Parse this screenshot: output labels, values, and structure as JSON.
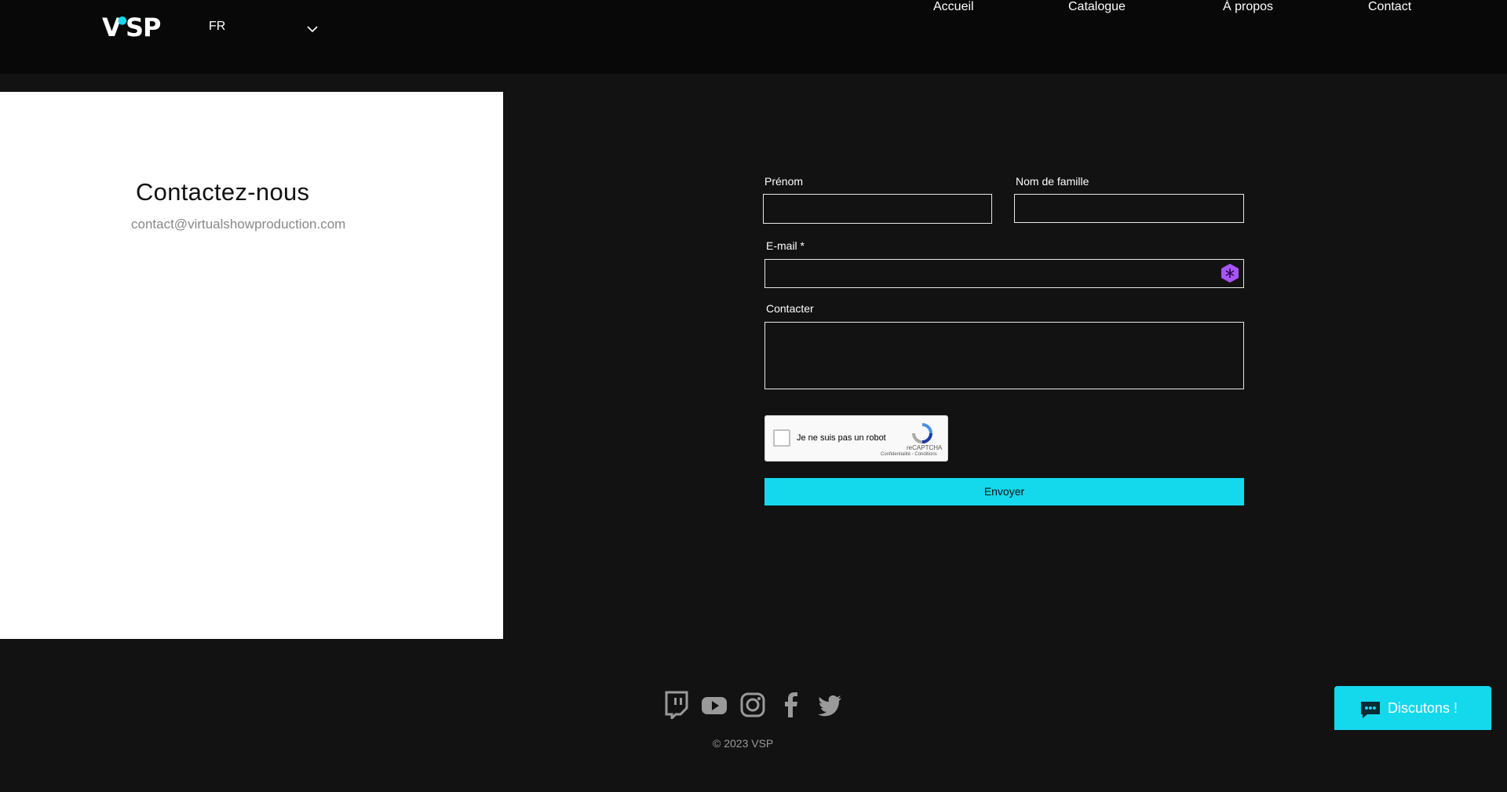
{
  "header": {
    "logo": {
      "text": "VSP"
    },
    "language": {
      "selected": "FR"
    },
    "nav": [
      {
        "label": "Accueil"
      },
      {
        "label": "Catalogue"
      },
      {
        "label": "À propos"
      },
      {
        "label": "Contact"
      }
    ]
  },
  "contact_panel": {
    "title": "Contactez-nous",
    "email": "contact@virtualshowproduction.com"
  },
  "form": {
    "first_name_label": "Prénom",
    "last_name_label": "Nom de famille",
    "email_label": "E-mail *",
    "message_label": "Contacter",
    "first_name_value": "",
    "last_name_value": "",
    "email_value": "",
    "message_value": "",
    "recaptcha": {
      "label": "Je ne suis pas un robot",
      "brand": "reCAPTCHA",
      "terms": "Confidentialité - Conditions"
    },
    "submit_label": "Envoyer"
  },
  "footer": {
    "social_icons": [
      "twitch-icon",
      "youtube-icon",
      "instagram-icon",
      "facebook-icon",
      "twitter-icon"
    ],
    "copyright": "© 2023 VSP"
  },
  "chat": {
    "label": "Discutons !"
  },
  "colors": {
    "accent": "#14d8ec",
    "background": "#121212",
    "header_bg": "#080808",
    "panel_bg": "#ffffff",
    "extension_icon": "#a855f7"
  }
}
